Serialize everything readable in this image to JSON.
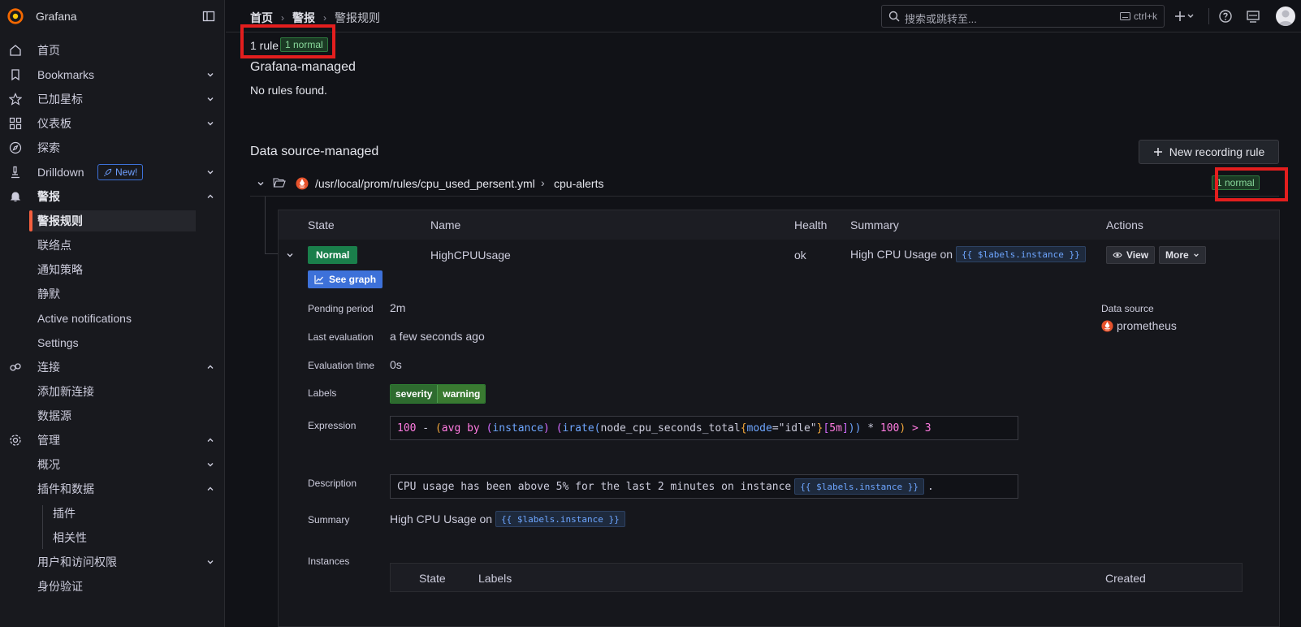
{
  "app": {
    "name": "Grafana"
  },
  "sidebar": {
    "items": [
      {
        "label": "首页"
      },
      {
        "label": "Bookmarks"
      },
      {
        "label": "已加星标"
      },
      {
        "label": "仪表板"
      },
      {
        "label": "探索"
      },
      {
        "label": "Drilldown",
        "badge": "New!"
      },
      {
        "label": "警报"
      },
      {
        "label": "警报规则"
      },
      {
        "label": "联络点"
      },
      {
        "label": "通知策略"
      },
      {
        "label": "静默"
      },
      {
        "label": "Active notifications"
      },
      {
        "label": "Settings"
      },
      {
        "label": "连接"
      },
      {
        "label": "添加新连接"
      },
      {
        "label": "数据源"
      },
      {
        "label": "管理"
      },
      {
        "label": "概况"
      },
      {
        "label": "插件和数据"
      },
      {
        "label": "插件"
      },
      {
        "label": "相关性"
      },
      {
        "label": "用户和访问权限"
      },
      {
        "label": "身份验证"
      }
    ]
  },
  "topbar": {
    "breadcrumbs": [
      "首页",
      "警报",
      "警报规则"
    ],
    "search_placeholder": "搜索或跳转至...",
    "search_shortcut": "ctrl+k"
  },
  "summary": {
    "rule_count": "1 rule",
    "normal_badge": "1 normal"
  },
  "grafana_managed": {
    "title": "Grafana-managed",
    "empty": "No rules found."
  },
  "datasource_managed": {
    "title": "Data source-managed",
    "new_button": "New recording rule",
    "namespace_path": "/usr/local/prom/rules/cpu_used_persent.yml",
    "group": "cpu-alerts",
    "group_badge": "1 normal"
  },
  "table": {
    "headers": {
      "state": "State",
      "name": "Name",
      "health": "Health",
      "summary": "Summary",
      "actions": "Actions"
    },
    "row": {
      "state": "Normal",
      "see_graph": "See graph",
      "name": "HighCPUUsage",
      "health": "ok",
      "summary_text": "High CPU Usage on",
      "summary_chip": "{{ $labels.instance }}",
      "view": "View",
      "more": "More"
    }
  },
  "details": {
    "pending_period_label": "Pending period",
    "pending_period": "2m",
    "last_eval_label": "Last evaluation",
    "last_eval": "a few seconds ago",
    "eval_time_label": "Evaluation time",
    "eval_time": "0s",
    "labels_label": "Labels",
    "label_key": "severity",
    "label_value": "warning",
    "expression_label": "Expression",
    "description_label": "Description",
    "description_text": "CPU usage has been above 5% for the last 2 minutes on instance",
    "description_chip": "{{ $labels.instance }}",
    "description_end": ".",
    "summary_label": "Summary",
    "summary_text": "High CPU Usage on",
    "summary_chip": "{{ $labels.instance }}",
    "instances_label": "Instances",
    "datasource_label": "Data source",
    "datasource_name": "prometheus"
  },
  "expression_tokens": [
    {
      "t": "100",
      "c": "#ff7be0"
    },
    {
      "t": " - ",
      "c": "#ccccdc"
    },
    {
      "t": "(",
      "c": "#f2a73b"
    },
    {
      "t": "avg",
      "c": "#ff7be0"
    },
    {
      "t": " by ",
      "c": "#ff7be0"
    },
    {
      "t": "(",
      "c": "#d36bff"
    },
    {
      "t": "instance",
      "c": "#6ea6ff"
    },
    {
      "t": ")",
      "c": "#d36bff"
    },
    {
      "t": " ",
      "c": "#ccccdc"
    },
    {
      "t": "(",
      "c": "#d36bff"
    },
    {
      "t": "irate",
      "c": "#6ea6ff"
    },
    {
      "t": "(",
      "c": "#6ea6ff"
    },
    {
      "t": "node_cpu_seconds_total",
      "c": "#ccccdc"
    },
    {
      "t": "{",
      "c": "#f2a73b"
    },
    {
      "t": "mode",
      "c": "#6ea6ff"
    },
    {
      "t": "=",
      "c": "#ccccdc"
    },
    {
      "t": "\"idle\"",
      "c": "#ccccdc"
    },
    {
      "t": "}",
      "c": "#f2a73b"
    },
    {
      "t": "[",
      "c": "#d36bff"
    },
    {
      "t": "5m",
      "c": "#ff7be0"
    },
    {
      "t": "]",
      "c": "#d36bff"
    },
    {
      "t": "))",
      "c": "#6ea6ff"
    },
    {
      "t": " * ",
      "c": "#ccccdc"
    },
    {
      "t": "100",
      "c": "#ff7be0"
    },
    {
      "t": ")",
      "c": "#f2a73b"
    },
    {
      "t": " > ",
      "c": "#ff7be0"
    },
    {
      "t": "3",
      "c": "#ff7be0"
    }
  ],
  "instances_table": {
    "state": "State",
    "labels": "Labels",
    "created": "Created"
  },
  "colors": {
    "accent": "#f55f3e",
    "normal_green": "#1a7f4b",
    "link_blue": "#3d71d9",
    "highlight_red": "#e31e1e"
  }
}
